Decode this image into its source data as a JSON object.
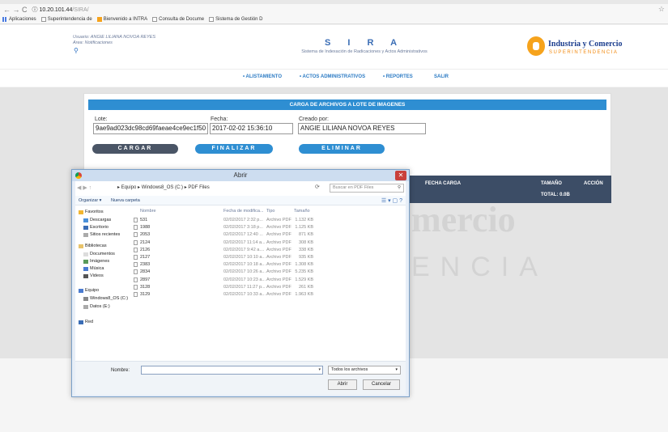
{
  "browser": {
    "nav_symbols": "←  →  C",
    "url_host": "ⓘ 10.20.101.44",
    "url_path": "/SIRA/",
    "bookmarks": [
      "Aplicaciones",
      "Superintendencia de",
      "Bienvenido a INTRA",
      "Consulta de Docume",
      "Sistema de Gestión D"
    ]
  },
  "header": {
    "user_line": "Usuario: ANGIE LILIANA NOVOA REYES",
    "area_line": "Area: Notificaciones",
    "title": "S I R A",
    "subtitle": "Sistema de Indexación de Radicaciones y Actos Administrativos",
    "logo_line1": "Industria y Comercio",
    "logo_line2": "SUPERINTENDENCIA"
  },
  "menu": [
    "• ALISTAMIENTO",
    "• ACTOS ADMINISTRATIVOS",
    "• REPORTES",
    "SALIR"
  ],
  "card": {
    "heading": "CARGA DE ARCHIVOS A LOTE DE IMAGENES",
    "lote_label": "Lote:",
    "lote_value": "9ae9ad023dc98cd69faeae4ce9ec1f50",
    "fecha_label": "Fecha:",
    "fecha_value": "2017-02-02 15:36:10",
    "creado_label": "Creado por:",
    "creado_value": "ANGIE LILIANA NOVOA REYES",
    "btn_cargar": "CARGAR",
    "btn_finalizar": "FINALIZAR",
    "btn_eliminar": "ELIMINAR"
  },
  "table": {
    "col_fecha": "FECHA CARGA",
    "col_tamano": "TAMAÑO",
    "col_accion": "ACCIÓN",
    "total": "TOTAL: 0.0B"
  },
  "watermark": {
    "line1": "mercio",
    "line2": "ENCIA"
  },
  "dialog": {
    "title": "Abrir",
    "breadcrumb": "▸ Equipo ▸ Windows8_OS (C:) ▸ PDF Files",
    "search_placeholder": "Buscar en PDF Files",
    "organize": "Organizar ▾",
    "new_folder": "Nueva carpeta",
    "nav_items": [
      {
        "label": "Favoritos",
        "color": "#f2b632"
      },
      {
        "label": "Descargas",
        "color": "#4a90d9"
      },
      {
        "label": "Escritorio",
        "color": "#3a6db5"
      },
      {
        "label": "Sitios recientes",
        "color": "#aaa"
      },
      {
        "label": "Bibliotecas",
        "color": "#e8c36a"
      },
      {
        "label": "Documentos",
        "color": "#ddd"
      },
      {
        "label": "Imágenes",
        "color": "#5a9a5a"
      },
      {
        "label": "Música",
        "color": "#4a7bd0"
      },
      {
        "label": "Videos",
        "color": "#555"
      },
      {
        "label": "Equipo",
        "color": "#4a7bd0"
      },
      {
        "label": "Windows8_OS (C:)",
        "color": "#888"
      },
      {
        "label": "Datos (E:)",
        "color": "#aaa"
      },
      {
        "label": "Red",
        "color": "#3a6db5"
      }
    ],
    "columns": {
      "name": "Nombre",
      "date": "Fecha de modifica...",
      "type": "Tipo",
      "size": "Tamaño"
    },
    "files": [
      {
        "name": "531",
        "date": "02/02/2017 2:32 p...",
        "type": "Archivo PDF",
        "size": "1.132 KB"
      },
      {
        "name": "1988",
        "date": "02/02/2017 3:18 p...",
        "type": "Archivo PDF",
        "size": "1.125 KB"
      },
      {
        "name": "2053",
        "date": "02/02/2017 12:40 ...",
        "type": "Archivo PDF",
        "size": "871 KB"
      },
      {
        "name": "2124",
        "date": "02/02/2017 11:14 a...",
        "type": "Archivo PDF",
        "size": "308 KB"
      },
      {
        "name": "2126",
        "date": "02/02/2017 9:42 a....",
        "type": "Archivo PDF",
        "size": "338 KB"
      },
      {
        "name": "2127",
        "date": "02/02/2017 10:10 a...",
        "type": "Archivo PDF",
        "size": "935 KB"
      },
      {
        "name": "2383",
        "date": "02/02/2017 10:18 a...",
        "type": "Archivo PDF",
        "size": "1.308 KB"
      },
      {
        "name": "2834",
        "date": "02/02/2017 10:26 a...",
        "type": "Archivo PDF",
        "size": "5.235 KB"
      },
      {
        "name": "2897",
        "date": "02/02/2017 10:23 a...",
        "type": "Archivo PDF",
        "size": "1.529 KB"
      },
      {
        "name": "3128",
        "date": "02/02/2017 11:27 p...",
        "type": "Archivo PDF",
        "size": "261 KB"
      },
      {
        "name": "3129",
        "date": "02/02/2017 10:33 a...",
        "type": "Archivo PDF",
        "size": "1.963 KB"
      }
    ],
    "name_label": "Nombre:",
    "name_value": "",
    "filter_value": "Todos los archivos",
    "btn_open": "Abrir",
    "btn_cancel": "Cancelar"
  }
}
